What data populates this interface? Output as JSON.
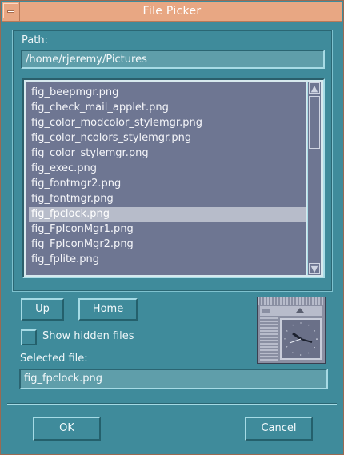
{
  "window": {
    "title": "File Picker"
  },
  "path": {
    "label": "Path:",
    "value": "/home/rjeremy/Pictures"
  },
  "files": [
    "fig_beepmgr.png",
    "fig_check_mail_applet.png",
    "fig_color_modcolor_stylemgr.png",
    "fig_color_ncolors_stylemgr.png",
    "fig_color_stylemgr.png",
    "fig_exec.png",
    "fig_fontmgr2.png",
    "fig_fontmgr.png",
    "fig_fpclock.png",
    "fig_FpIconMgr1.png",
    "fig_FpIconMgr2.png",
    "fig_fplite.png"
  ],
  "selected_index": 8,
  "nav": {
    "up_label": "Up",
    "home_label": "Home"
  },
  "hidden": {
    "label": "Show hidden files",
    "checked": false
  },
  "selected": {
    "label": "Selected file:",
    "value": "fig_fpclock.png"
  },
  "actions": {
    "ok_label": "OK",
    "cancel_label": "Cancel"
  },
  "colors": {
    "title_bar": "#e8a783",
    "window_bg": "#3f8b9b",
    "list_bg": "#6e7692",
    "selection": "#b7bcca"
  },
  "icons": {
    "preview": "clock-preview-icon",
    "scroll_up": "scroll-up-arrow-icon",
    "scroll_down": "scroll-down-arrow-icon"
  }
}
